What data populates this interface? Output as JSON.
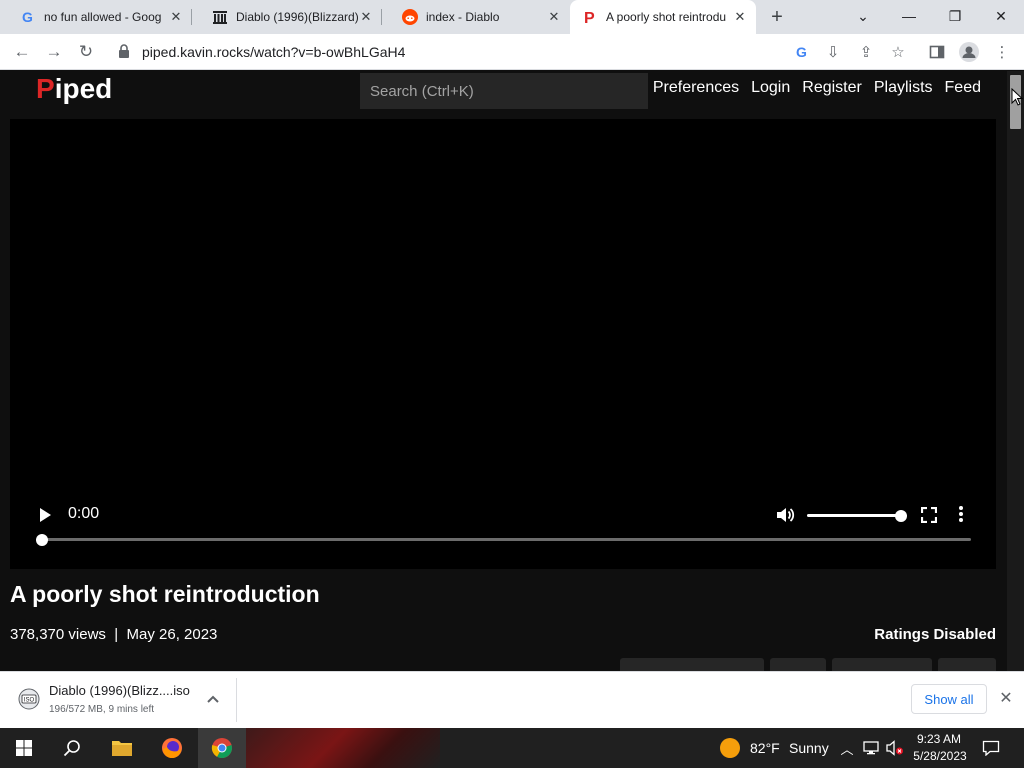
{
  "browser": {
    "tabs": [
      {
        "label": "no fun allowed - Goog",
        "icon": "google-icon",
        "active": false
      },
      {
        "label": "Diablo (1996)(Blizzard)",
        "icon": "archive-icon",
        "active": false
      },
      {
        "label": "index - Diablo",
        "icon": "reddit-icon",
        "active": false
      },
      {
        "label": "A poorly shot reintrodu",
        "icon": "piped-icon",
        "active": true
      }
    ],
    "url": "piped.kavin.rocks/watch?v=b-owBhLGaH4"
  },
  "piped": {
    "logo": {
      "first": "P",
      "rest": "iped"
    },
    "search_placeholder": "Search (Ctrl+K)",
    "nav": [
      "Preferences",
      "Login",
      "Register",
      "Playlists",
      "Feed"
    ],
    "player": {
      "time": "0:00",
      "progress": 0,
      "volume": 1.0
    },
    "video": {
      "title": "A poorly shot reintroduction",
      "views": "378,370 views",
      "separator": "|",
      "date": "May 26, 2023",
      "ratings": "Ratings Disabled"
    }
  },
  "download": {
    "filename": "Diablo (1996)(Blizz....iso",
    "status": "196/572 MB, 9 mins left",
    "show_all": "Show all"
  },
  "taskbar": {
    "weather": {
      "temp": "82°F",
      "condition": "Sunny"
    },
    "clock": {
      "time": "9:23 AM",
      "date": "5/28/2023"
    }
  },
  "colors": {
    "piped_red": "#dc2626",
    "page_bg": "#0f0f0f",
    "link_blue": "#1a73e8"
  }
}
